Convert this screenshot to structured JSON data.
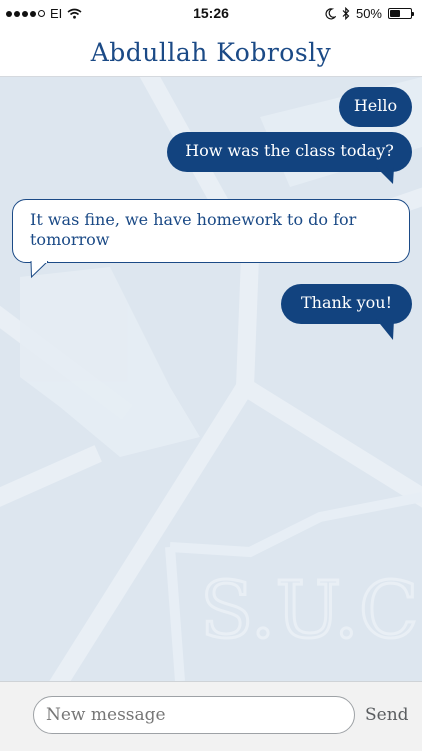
{
  "status_bar": {
    "carrier": "EI",
    "time": "15:26",
    "battery_percent": "50%",
    "battery_level": 0.5,
    "signal_strength": 4,
    "signal_max": 5
  },
  "header": {
    "title": "Abdullah Kobrosly"
  },
  "messages": [
    {
      "direction": "outgoing",
      "text": "Hello"
    },
    {
      "direction": "outgoing",
      "text": "How was the class today?"
    },
    {
      "direction": "incoming",
      "text": "It was fine, we have homework to do for tomorrow"
    },
    {
      "direction": "outgoing",
      "text": "Thank you!"
    }
  ],
  "composer": {
    "placeholder": "New message",
    "send_label": "Send"
  },
  "background": {
    "watermark": "S.U.C"
  },
  "colors": {
    "accent": "#12437f",
    "chat_background": "#dde6ef"
  }
}
